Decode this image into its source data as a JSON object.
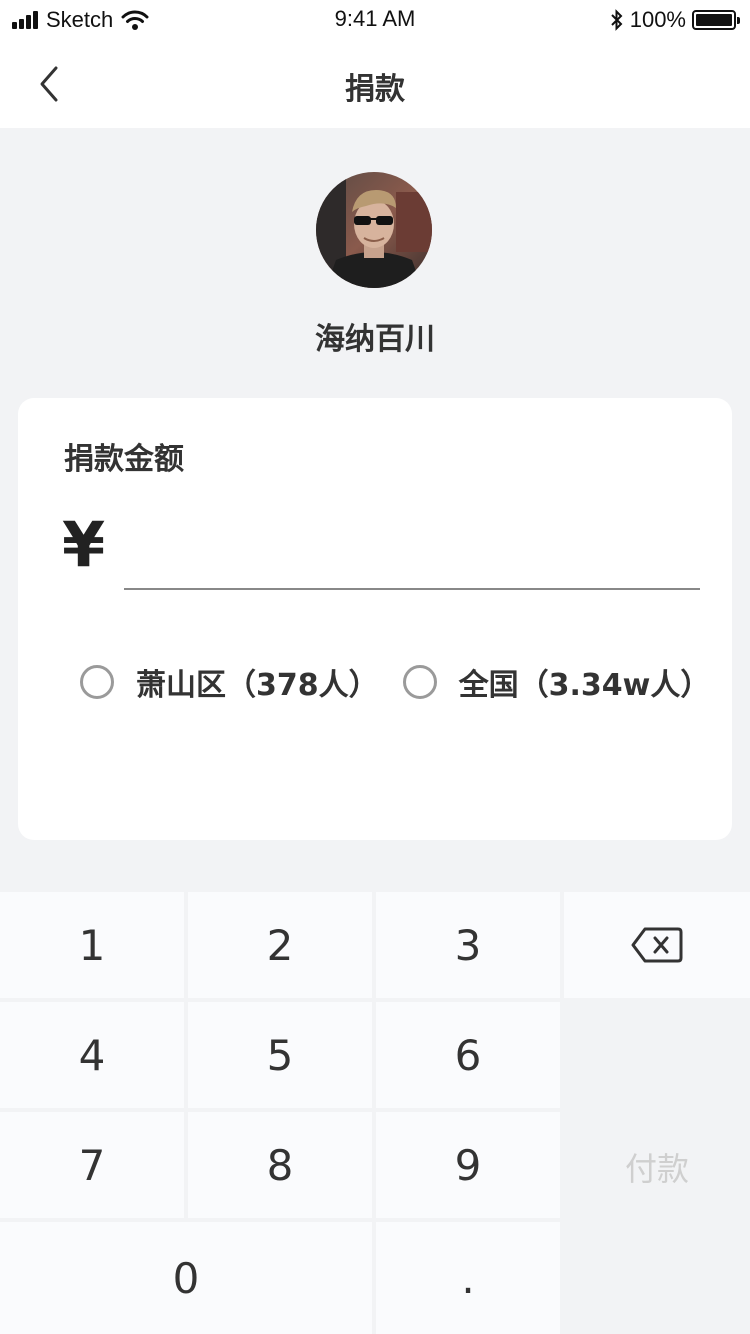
{
  "status_bar": {
    "carrier": "Sketch",
    "time": "9:41 AM",
    "battery": "100%",
    "icons": [
      "signal-icon",
      "wifi-icon",
      "bluetooth-icon",
      "battery-icon"
    ]
  },
  "nav": {
    "title": "捐款",
    "back_icon": "chevron-left-icon"
  },
  "profile": {
    "name": "海纳百川"
  },
  "donation": {
    "amount_label": "捐款金额",
    "currency_symbol": "¥",
    "amount_value": "",
    "options": [
      {
        "label": "萧山区（378人）",
        "selected": false
      },
      {
        "label": "全国（3.34w人）",
        "selected": false
      }
    ]
  },
  "keypad": {
    "keys": [
      "1",
      "2",
      "3",
      "4",
      "5",
      "6",
      "7",
      "8",
      "9",
      "0",
      "."
    ],
    "backspace_icon": "backspace-icon",
    "pay_label": "付款"
  },
  "colors": {
    "background": "#f2f3f5",
    "card": "#ffffff",
    "text": "#333333",
    "pay_disabled_text": "#cfcfcf"
  }
}
